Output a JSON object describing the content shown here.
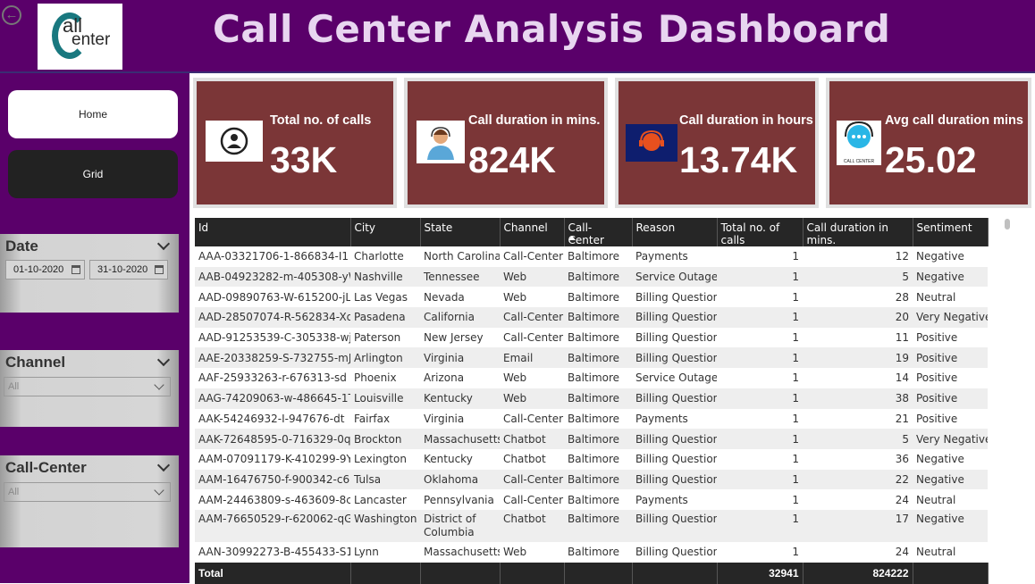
{
  "header": {
    "title": "Call Center Analysis Dashboard",
    "logo_text_1": "all",
    "logo_text_2": "enter"
  },
  "nav": {
    "home": "Home",
    "grid": "Grid"
  },
  "filters": {
    "date": {
      "title": "Date",
      "start": "01-10-2020",
      "end": "31-10-2020"
    },
    "channel": {
      "title": "Channel",
      "value": "All"
    },
    "call_center": {
      "title": "Call-Center",
      "value": "All"
    }
  },
  "cards": [
    {
      "label": "Total no. of calls",
      "value": "33K"
    },
    {
      "label": "Call duration in mins.",
      "value": "824K"
    },
    {
      "label": "Call duration in hours",
      "value": "13.74K"
    },
    {
      "label": "Avg call duration mins",
      "value": "25.02",
      "icon_text": "CALL CENTER"
    }
  ],
  "table": {
    "columns": [
      "Id",
      "City",
      "State",
      "Channel",
      "Call-Center",
      "Reason",
      "Total no. of calls",
      "Call duration in mins.",
      "Sentiment"
    ],
    "rows": [
      [
        "AAA-03321706-1-866834-I1",
        "Charlotte",
        "North Carolina",
        "Call-Center",
        "Baltimore",
        "Payments",
        "1",
        "12",
        "Negative"
      ],
      [
        "AAB-04923282-m-405308-yW",
        "Nashville",
        "Tennessee",
        "Web",
        "Baltimore",
        "Service Outage",
        "1",
        "5",
        "Negative"
      ],
      [
        "AAD-09890763-W-615200-jL",
        "Las Vegas",
        "Nevada",
        "Web",
        "Baltimore",
        "Billing Question",
        "1",
        "28",
        "Neutral"
      ],
      [
        "AAD-28507074-R-562834-Xd",
        "Pasadena",
        "California",
        "Call-Center",
        "Baltimore",
        "Billing Question",
        "1",
        "20",
        "Very Negative"
      ],
      [
        "AAD-91253539-C-305338-wj",
        "Paterson",
        "New Jersey",
        "Call-Center",
        "Baltimore",
        "Billing Question",
        "1",
        "11",
        "Positive"
      ],
      [
        "AAE-20338259-S-732755-mJ",
        "Arlington",
        "Virginia",
        "Email",
        "Baltimore",
        "Billing Question",
        "1",
        "19",
        "Positive"
      ],
      [
        "AAF-25933263-r-676313-sd",
        "Phoenix",
        "Arizona",
        "Web",
        "Baltimore",
        "Service Outage",
        "1",
        "14",
        "Positive"
      ],
      [
        "AAG-74209063-w-486645-1T",
        "Louisville",
        "Kentucky",
        "Web",
        "Baltimore",
        "Billing Question",
        "1",
        "38",
        "Positive"
      ],
      [
        "AAK-54246932-I-947676-dt",
        "Fairfax",
        "Virginia",
        "Call-Center",
        "Baltimore",
        "Payments",
        "1",
        "21",
        "Positive"
      ],
      [
        "AAK-72648595-0-716329-0q",
        "Brockton",
        "Massachusetts",
        "Chatbot",
        "Baltimore",
        "Billing Question",
        "1",
        "5",
        "Very Negative"
      ],
      [
        "AAM-07091179-K-410299-9Y",
        "Lexington",
        "Kentucky",
        "Chatbot",
        "Baltimore",
        "Billing Question",
        "1",
        "36",
        "Negative"
      ],
      [
        "AAM-16476750-f-900342-c6",
        "Tulsa",
        "Oklahoma",
        "Call-Center",
        "Baltimore",
        "Billing Question",
        "1",
        "22",
        "Negative"
      ],
      [
        "AAM-24463809-s-463609-8c",
        "Lancaster",
        "Pennsylvania",
        "Call-Center",
        "Baltimore",
        "Payments",
        "1",
        "24",
        "Neutral"
      ],
      [
        "AAM-76650529-r-620062-qG",
        "Washington",
        "District of Columbia",
        "Chatbot",
        "Baltimore",
        "Billing Question",
        "1",
        "17",
        "Negative"
      ],
      [
        "AAN-30992273-B-455433-S1",
        "Lynn",
        "Massachusetts",
        "Web",
        "Baltimore",
        "Billing Question",
        "1",
        "24",
        "Neutral"
      ]
    ],
    "total": {
      "label": "Total",
      "calls": "32941",
      "minutes": "824222"
    }
  },
  "colors": {
    "header_bg": "#5a006a",
    "card_bg": "#7b3637",
    "title_text": "#e8d6f0",
    "table_header": "#262626"
  }
}
